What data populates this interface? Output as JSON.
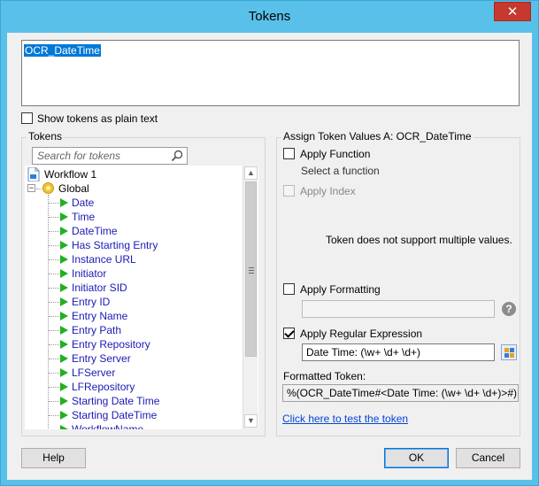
{
  "window": {
    "title": "Tokens",
    "close_glyph": "✕"
  },
  "editor": {
    "value": "OCR_DateTime"
  },
  "plain_text_option": {
    "label": "Show tokens as plain text",
    "checked": false
  },
  "tokens_panel": {
    "title": "Tokens",
    "search_placeholder": "Search for tokens",
    "tree": {
      "root": "Workflow 1",
      "group": "Global",
      "group_expander": "−",
      "items": [
        "Date",
        "Time",
        "DateTime",
        "Has Starting Entry",
        "Instance URL",
        "Initiator",
        "Initiator SID",
        "Entry ID",
        "Entry Name",
        "Entry Path",
        "Entry Repository",
        "Entry Server",
        "LFServer",
        "LFRepository",
        "Starting Date Time",
        "Starting DateTime",
        "WorkflowName"
      ]
    },
    "scroll_up": "▲",
    "scroll_down": "▼"
  },
  "assign_panel": {
    "title": "Assign Token Values A: OCR_DateTime",
    "apply_function": {
      "label": "Apply Function",
      "checked": false
    },
    "select_function_text": "Select a function",
    "apply_index": {
      "label": "Apply Index",
      "checked": false,
      "enabled": false
    },
    "multi_values_message": "Token does not support multiple values.",
    "apply_formatting": {
      "label": "Apply Formatting",
      "checked": false,
      "value": ""
    },
    "help_glyph": "?",
    "apply_regex": {
      "label": "Apply Regular Expression",
      "checked": true,
      "value": "Date Time: (\\w+ \\d+ \\d+)"
    },
    "formatted_token": {
      "label": "Formatted Token:",
      "value": "%(OCR_DateTime#<Date Time: (\\w+ \\d+ \\d+)>#)"
    },
    "test_link": "Click here to test the token"
  },
  "footer": {
    "help": "Help",
    "ok": "OK",
    "cancel": "Cancel"
  },
  "colors": {
    "title_bar": "#59c1e9",
    "close_button": "#c7382e",
    "token_text": "#1a1ab5",
    "token_icon": "#21b021",
    "link": "#0645d6",
    "selection": "#0078d7"
  }
}
